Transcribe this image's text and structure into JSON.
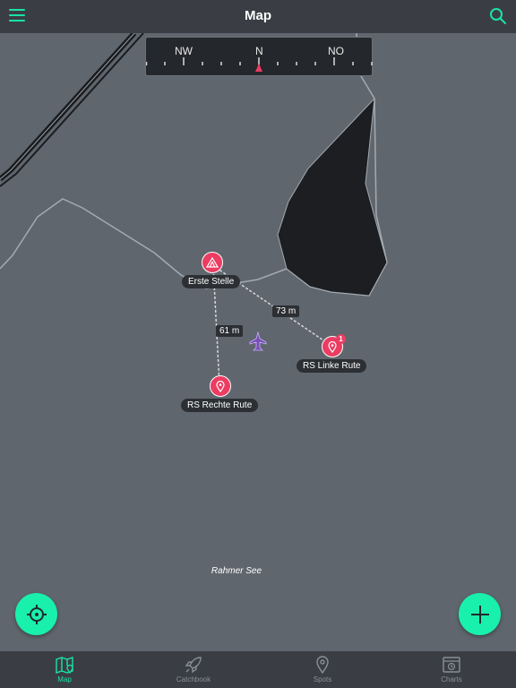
{
  "header": {
    "title": "Map"
  },
  "compass": {
    "labels": [
      "NW",
      "N",
      "NO"
    ]
  },
  "spots": [
    {
      "label": "Erste Stelle"
    },
    {
      "label": "RS Linke Rute",
      "badge": "1"
    },
    {
      "label": "RS Rechte Rute"
    }
  ],
  "distances": [
    "73 m",
    "61 m"
  ],
  "map": {
    "lake_name": "Rahmer See"
  },
  "tabs": [
    {
      "label": "Map",
      "icon": "map-icon",
      "active": true
    },
    {
      "label": "Catchbook",
      "icon": "rocket-icon",
      "active": false
    },
    {
      "label": "Spots",
      "icon": "pin-icon",
      "active": false
    },
    {
      "label": "Charts",
      "icon": "charts-icon",
      "active": false
    }
  ],
  "colors": {
    "accent": "#19e3a8",
    "fab": "#19f0ac",
    "pin": "#ec3c62",
    "bar": "#3a3e44",
    "water": "#5f666e"
  }
}
